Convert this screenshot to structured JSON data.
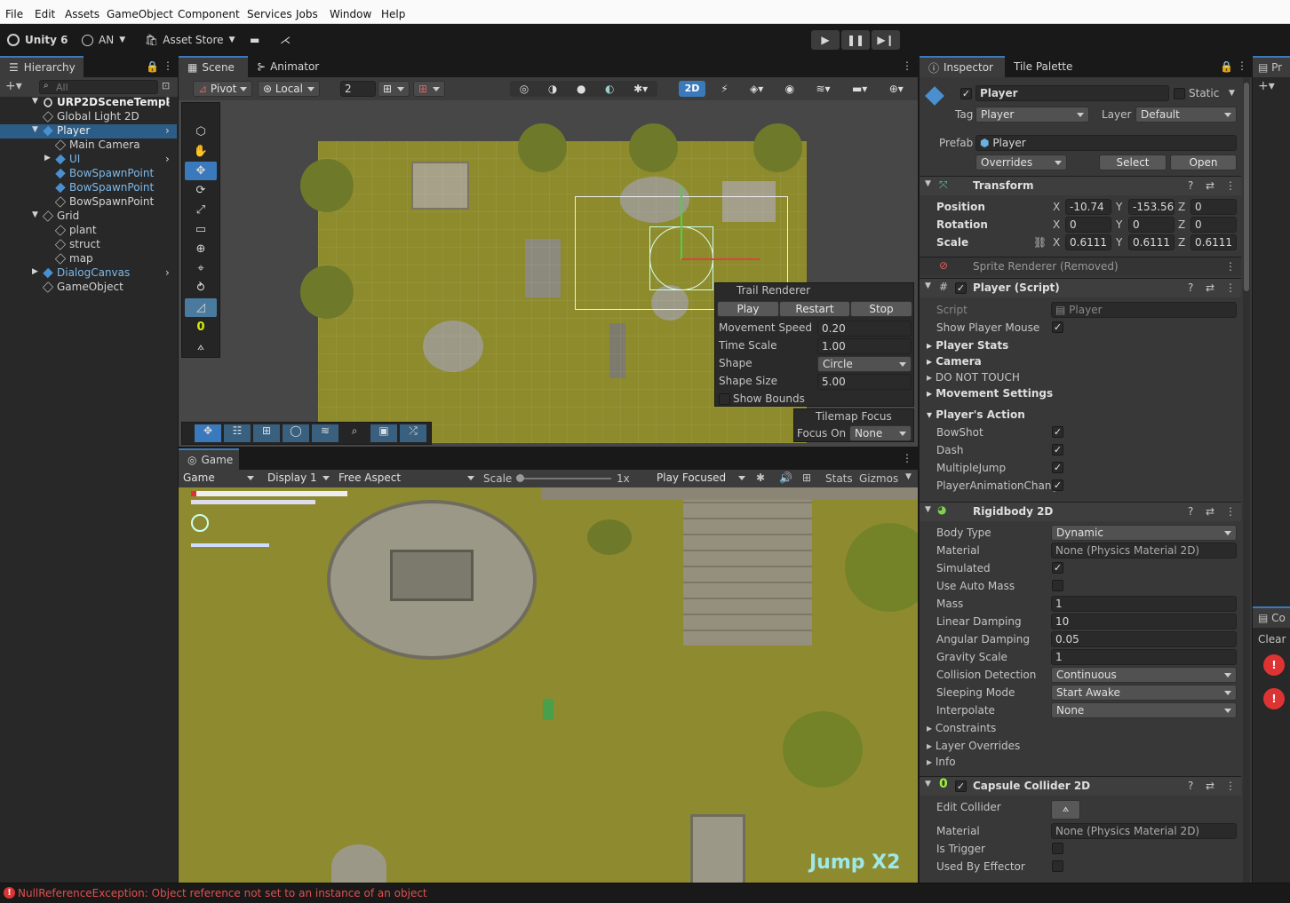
{
  "menu": [
    "File",
    "Edit",
    "Assets",
    "GameObject",
    "Component",
    "Services",
    "Jobs",
    "Window",
    "Help"
  ],
  "toolbar": {
    "unity": "Unity 6",
    "account": "AN",
    "store": "Asset Store"
  },
  "hierarchy": {
    "tab": "Hierarchy",
    "search": "All",
    "items": [
      {
        "label": "URP2DSceneTempl",
        "indent": 0,
        "icon": "scene-icon"
      },
      {
        "label": "Global Light 2D",
        "indent": 1,
        "icon": "cube-icon"
      },
      {
        "label": "Player",
        "indent": 1,
        "icon": "prefab-icon"
      },
      {
        "label": "Main Camera",
        "indent": 2,
        "icon": "cube-icon"
      },
      {
        "label": "UI",
        "indent": 2,
        "icon": "prefab-icon"
      },
      {
        "label": "BowSpawnPoint",
        "indent": 2,
        "icon": "prefab-icon"
      },
      {
        "label": "BowSpawnPoint",
        "indent": 2,
        "icon": "prefab-icon"
      },
      {
        "label": "BowSpawnPoint",
        "indent": 2,
        "icon": "cube-icon"
      },
      {
        "label": "Grid",
        "indent": 1,
        "icon": "cube-icon"
      },
      {
        "label": "plant",
        "indent": 2,
        "icon": "cube-icon"
      },
      {
        "label": "struct",
        "indent": 2,
        "icon": "cube-icon"
      },
      {
        "label": "map",
        "indent": 2,
        "icon": "cube-icon"
      },
      {
        "label": "DialogCanvas",
        "indent": 1,
        "icon": "prefab-icon"
      },
      {
        "label": "GameObject",
        "indent": 1,
        "icon": "cube-icon"
      }
    ]
  },
  "scene": {
    "tabs": [
      "Scene",
      "Animator"
    ],
    "pivot": "Pivot",
    "local": "Local",
    "grid": "2",
    "mode2d": "2D",
    "trail": {
      "title": "Trail Renderer",
      "play": "Play",
      "restart": "Restart",
      "stop": "Stop",
      "rows": [
        {
          "k": "Movement Speed",
          "v": "0.20"
        },
        {
          "k": "Time Scale",
          "v": "1.00"
        },
        {
          "k": "Shape",
          "v": "Circle"
        },
        {
          "k": "Shape Size",
          "v": "5.00"
        }
      ],
      "bounds": "Show Bounds"
    },
    "tilemap": {
      "title": "Tilemap Focus",
      "focus": "Focus On",
      "value": "None"
    },
    "zero": "0"
  },
  "game": {
    "tab": "Game",
    "view": "Game",
    "display": "Display 1",
    "aspect": "Free Aspect",
    "scale_label": "Scale",
    "scale": "1x",
    "focus": "Play Focused",
    "stats": "Stats",
    "gizmos": "Gizmos",
    "jump": "Jump X2"
  },
  "inspector": {
    "tabs": [
      "Inspector",
      "Tile Palette"
    ],
    "name": "Player",
    "static": "Static",
    "tag_label": "Tag",
    "tag": "Player",
    "layer_label": "Layer",
    "layer": "Default",
    "prefab_label": "Prefab",
    "prefab": "Player",
    "overrides": "Overrides",
    "select": "Select",
    "open": "Open",
    "transform": {
      "title": "Transform",
      "rows": [
        {
          "k": "Position",
          "x": "-10.74",
          "y": "-153.56",
          "z": "0"
        },
        {
          "k": "Rotation",
          "x": "0",
          "y": "0",
          "z": "0"
        },
        {
          "k": "Scale",
          "x": "0.6111",
          "y": "0.6111",
          "z": "0.6111"
        }
      ]
    },
    "sprite": "Sprite Renderer (Removed)",
    "script": {
      "title": "Player (Script)",
      "script_label": "Script",
      "script_value": "Player",
      "mouse": "Show Player Mouse",
      "groups": [
        "Player Stats",
        "Camera",
        "DO NOT TOUCH",
        "Movement Settings"
      ],
      "action": "Player's Action",
      "actions": [
        "BowShot",
        "Dash",
        "MultipleJump",
        "PlayerAnimationChang"
      ]
    },
    "rb": {
      "title": "Rigidbody 2D",
      "rows": [
        {
          "k": "Body Type",
          "v": "Dynamic",
          "t": "dd"
        },
        {
          "k": "Material",
          "v": "None (Physics Material 2D)",
          "t": "obj"
        },
        {
          "k": "Simulated",
          "v": "✓",
          "t": "chk"
        },
        {
          "k": "Use Auto Mass",
          "v": "",
          "t": "chk"
        },
        {
          "k": "Mass",
          "v": "1",
          "t": "field"
        },
        {
          "k": "Linear Damping",
          "v": "10",
          "t": "field"
        },
        {
          "k": "Angular Damping",
          "v": "0.05",
          "t": "field"
        },
        {
          "k": "Gravity Scale",
          "v": "1",
          "t": "field"
        },
        {
          "k": "Collision Detection",
          "v": "Continuous",
          "t": "dd"
        },
        {
          "k": "Sleeping Mode",
          "v": "Start Awake",
          "t": "dd"
        },
        {
          "k": "Interpolate",
          "v": "None",
          "t": "dd"
        }
      ],
      "groups": [
        "Constraints",
        "Layer Overrides",
        "Info"
      ]
    },
    "capsule": {
      "title": "Capsule Collider 2D",
      "zero": "0",
      "edit": "Edit Collider",
      "material_label": "Material",
      "material": "None (Physics Material 2D)",
      "trigger": "Is Trigger",
      "effector": "Used By Effector"
    }
  },
  "right": {
    "pr": "Pr",
    "co": "Co",
    "clear": "Clear"
  },
  "status": {
    "error": "NullReferenceException: Object reference not set to an instance of an object",
    "color": "#e05050"
  },
  "colors": {
    "accent": "#3a79bb",
    "grass": "#8d8b2c",
    "selection": "#2c5d87"
  }
}
